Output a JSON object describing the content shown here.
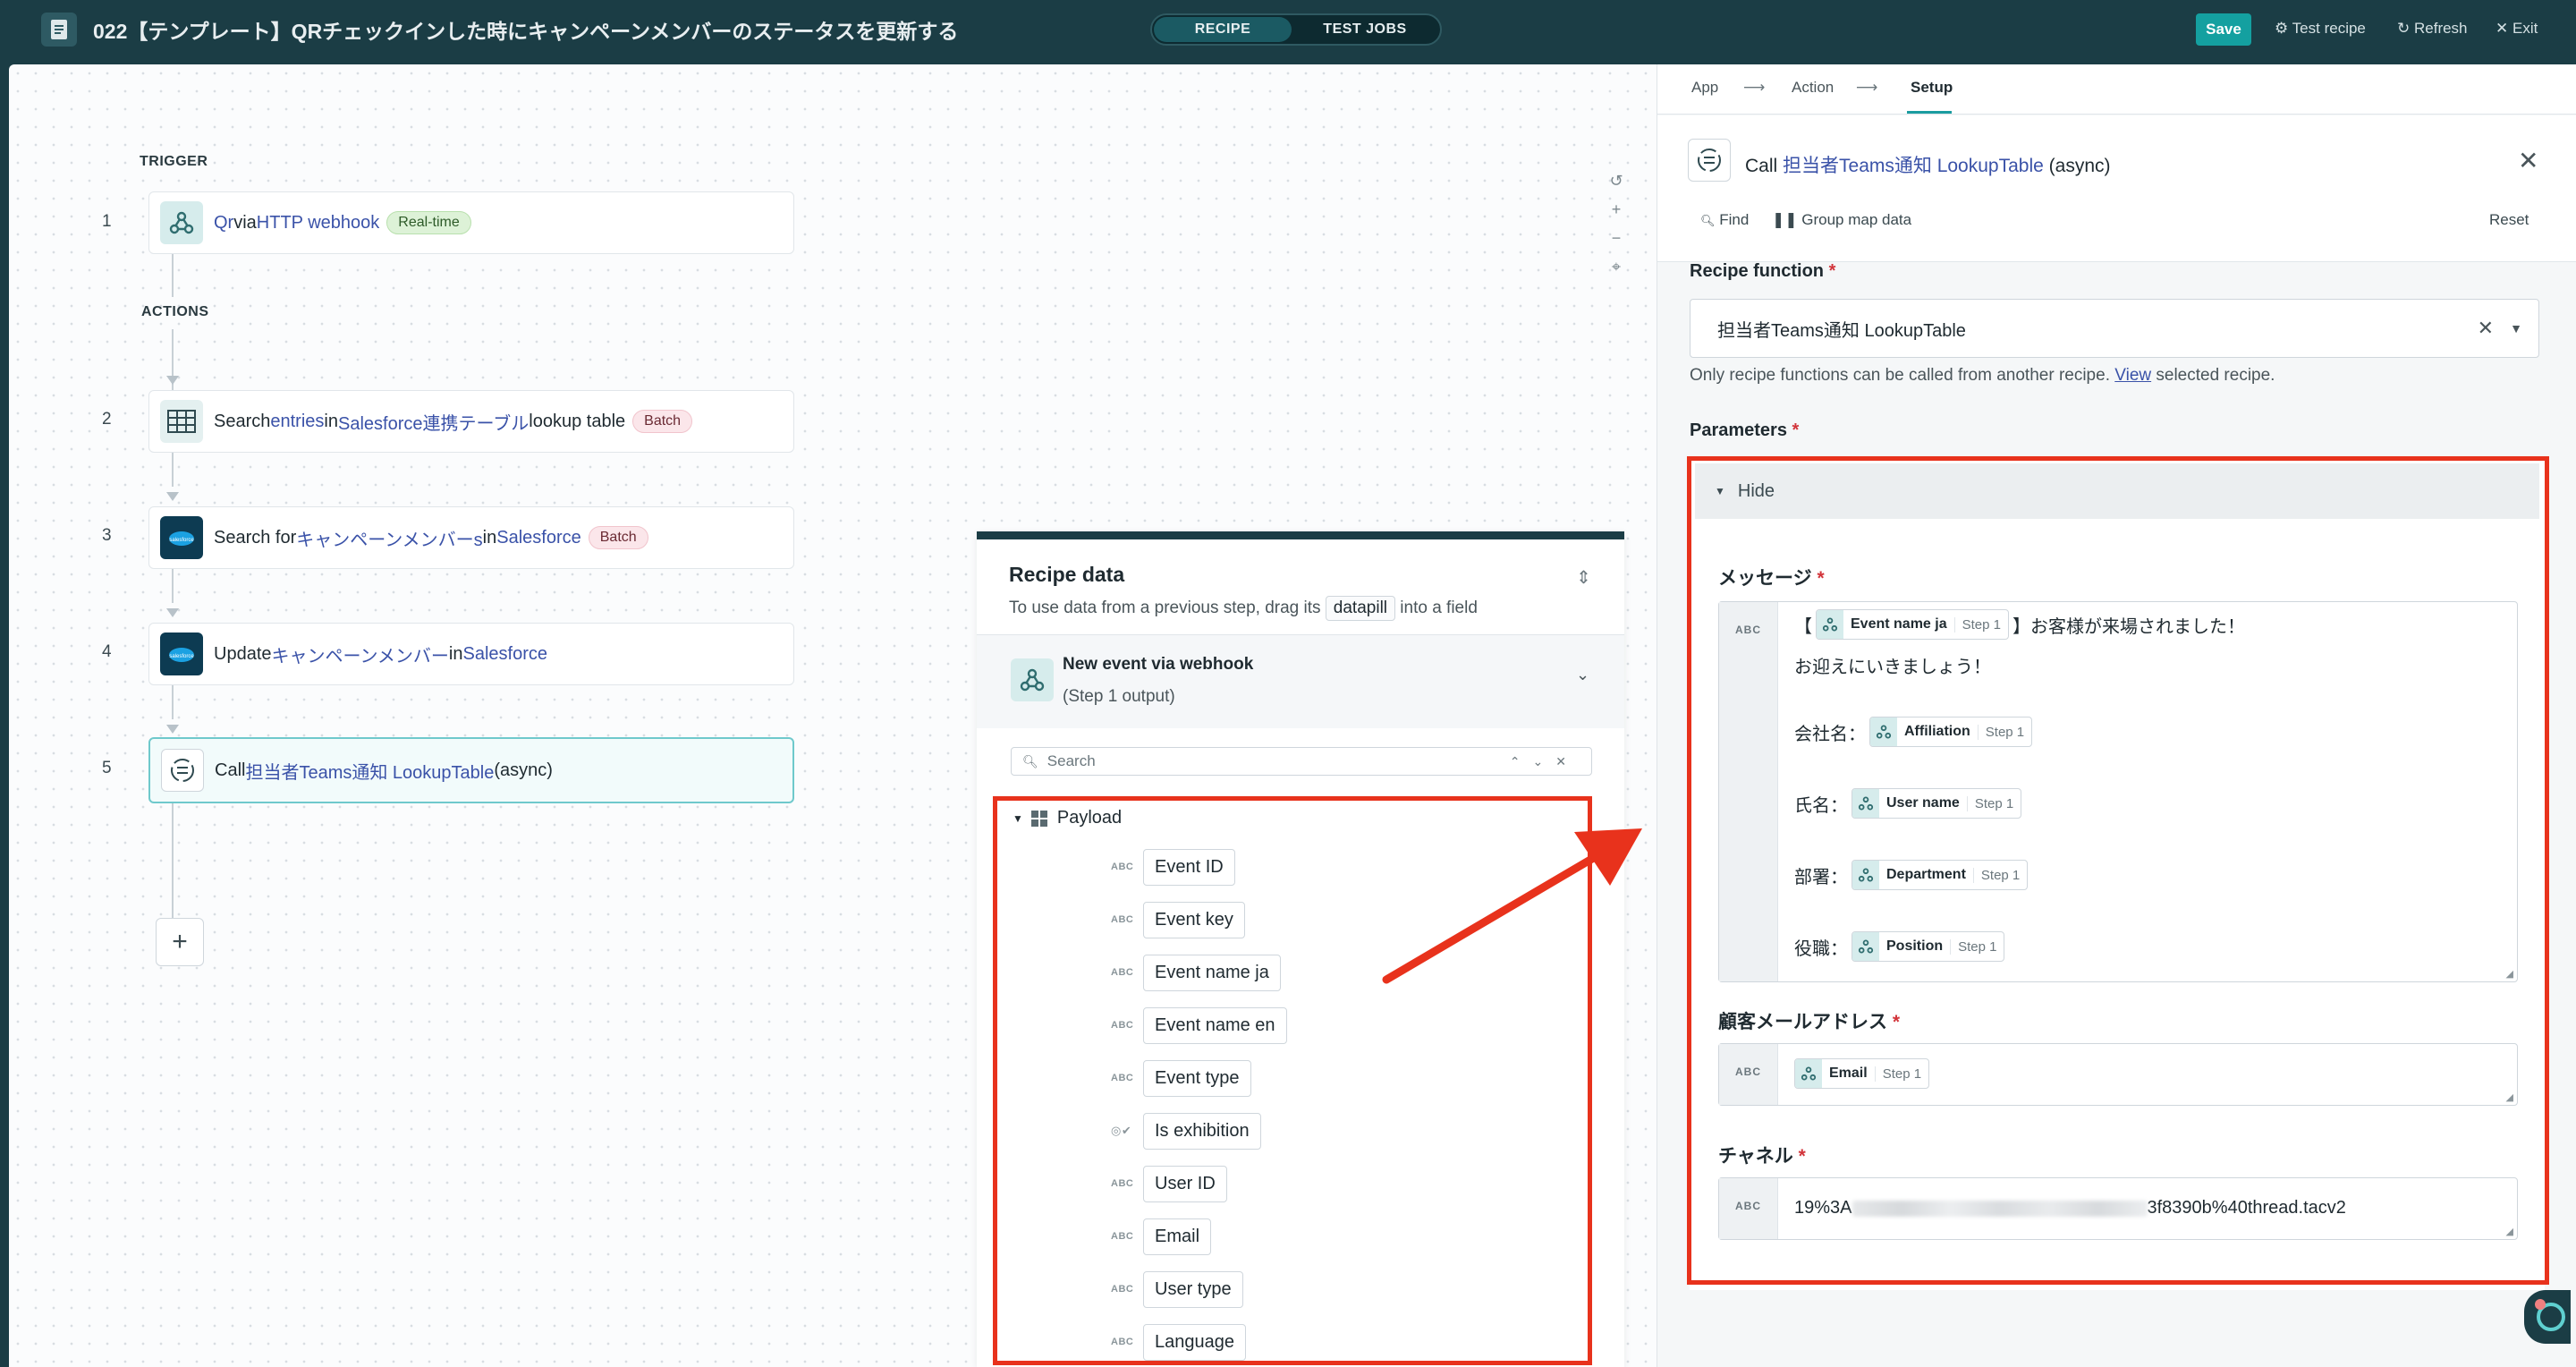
{
  "topbar": {
    "title": "022【テンプレート】QRチェックインした時にキャンペーンメンバーのステータスを更新する",
    "tab_recipe": "RECIPE",
    "tab_test_jobs": "TEST JOBS",
    "save": "Save",
    "test_recipe": "Test recipe",
    "refresh": "Refresh",
    "exit": "Exit"
  },
  "canvas": {
    "trigger_label": "TRIGGER",
    "actions_label": "ACTIONS",
    "steps": [
      {
        "num": "1",
        "parts": [
          "Qr",
          " via ",
          "HTTP webhook"
        ],
        "badge": "Real-time"
      },
      {
        "num": "2",
        "parts": [
          "Search ",
          "entries",
          " in ",
          "Salesforce連携テーブル",
          " lookup table"
        ],
        "badge": "Batch"
      },
      {
        "num": "3",
        "parts": [
          "Search for ",
          "キャンペーンメンバーs",
          " in ",
          "Salesforce"
        ],
        "badge": "Batch"
      },
      {
        "num": "4",
        "parts": [
          "Update ",
          "キャンペーンメンバー",
          " in ",
          "Salesforce"
        ]
      },
      {
        "num": "5",
        "parts": [
          "Call ",
          "担当者Teams通知 LookupTable",
          " (async)"
        ]
      }
    ],
    "add_step": "+"
  },
  "recipe_data": {
    "title": "Recipe data",
    "subtitle_before": "To use data from a previous step, drag its ",
    "subtitle_pill": "datapill",
    "subtitle_after": " into a field",
    "event_title": "New event via webhook",
    "event_sub": "(Step 1 output)",
    "search_placeholder": "Search",
    "payload_label": "Payload",
    "fields": [
      {
        "type": "ABC",
        "name": "Event ID"
      },
      {
        "type": "ABC",
        "name": "Event key"
      },
      {
        "type": "ABC",
        "name": "Event name ja"
      },
      {
        "type": "ABC",
        "name": "Event name en"
      },
      {
        "type": "ABC",
        "name": "Event type"
      },
      {
        "type": "bool",
        "name": "Is exhibition"
      },
      {
        "type": "ABC",
        "name": "User ID"
      },
      {
        "type": "ABC",
        "name": "Email"
      },
      {
        "type": "ABC",
        "name": "User type"
      },
      {
        "type": "ABC",
        "name": "Language"
      }
    ]
  },
  "setup": {
    "crumb_app": "App",
    "crumb_action": "Action",
    "crumb_setup": "Setup",
    "call_prefix": "Call ",
    "call_link": "担当者Teams通知 LookupTable",
    "call_suffix": " (async)",
    "find": "Find",
    "group_map": "Group map data",
    "reset": "Reset",
    "recipe_function_label": "Recipe function",
    "recipe_function_value": "担当者Teams通知 LookupTable",
    "help_before": "Only recipe functions can be called from another recipe. ",
    "help_link": "View",
    "help_after": " selected recipe.",
    "parameters_label": "Parameters",
    "hide": "Hide",
    "message_label": "メッセージ",
    "msg_open": "【",
    "msg_close": "】お客様が来場されました！",
    "msg_line2": "お迎えにいきましょう！",
    "company": "会社名：",
    "name": "氏名：",
    "dept": "部署：",
    "pos": "役職：",
    "pill_event": "Event name ja",
    "pill_affiliation": "Affiliation",
    "pill_user": "User name",
    "pill_dept": "Department",
    "pill_pos": "Position",
    "pill_email": "Email",
    "step1": "Step 1",
    "email_label": "顧客メールアドレス",
    "channel_label": "チャネル",
    "channel_start": "19%3A",
    "channel_end": "3f8390b%40thread.tacv2",
    "abc": "ABC",
    "required": "*"
  },
  "colors": {
    "accent": "#1a9ca0",
    "highlight": "#e8321c",
    "link": "#3a52a8"
  }
}
